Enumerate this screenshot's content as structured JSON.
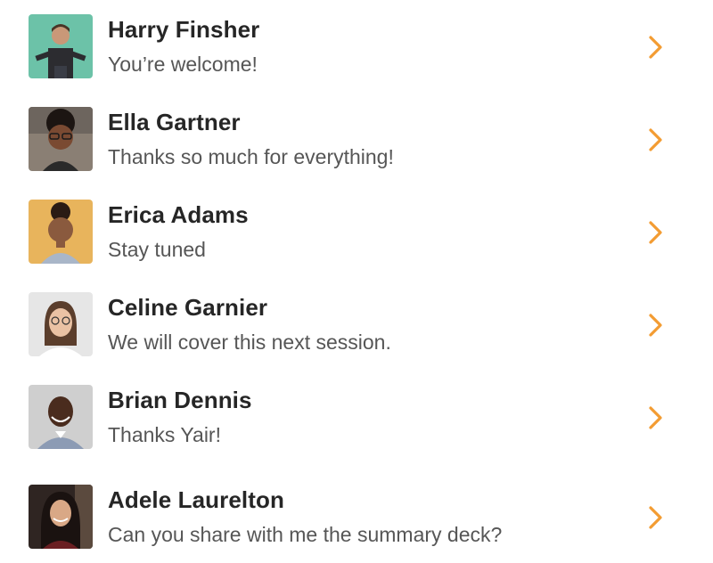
{
  "conversations": [
    {
      "name": "Harry Finsher",
      "message": "You’re welcome!",
      "avatar_bg": "#6cc2a8"
    },
    {
      "name": "Ella Gartner",
      "message": "Thanks so much for everything!",
      "avatar_bg": "#8a7f74"
    },
    {
      "name": "Erica Adams",
      "message": "Stay tuned",
      "avatar_bg": "#e8b45c"
    },
    {
      "name": "Celine Garnier",
      "message": "We will cover this next session.",
      "avatar_bg": "#e6e6e6"
    },
    {
      "name": "Brian Dennis",
      "message": "Thanks Yair!",
      "avatar_bg": "#cfcfcf"
    },
    {
      "name": "Adele Laurelton",
      "message": "Can you share with me the summary deck?",
      "avatar_bg": "#2f2522"
    }
  ],
  "icons": {
    "chevron": "chevron-right-icon"
  },
  "colors": {
    "accent": "#f39c32",
    "name_text": "#262626",
    "message_text": "#565656"
  }
}
